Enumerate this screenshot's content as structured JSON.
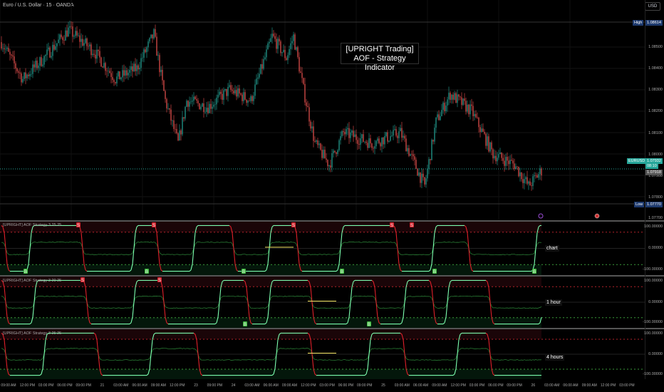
{
  "header": {
    "symbol_title": "Euro / U.S. Dollar · 15 · OANDA",
    "currency": "USD"
  },
  "annotation": {
    "line1": "[UPRIGHT Trading]",
    "line2": "AOF - Strategy Indicator"
  },
  "price_axis": {
    "labels": [
      "1.08500",
      "1.08400",
      "1.08300",
      "1.08200",
      "1.08100",
      "1.08000",
      "1.07900",
      "1.07800",
      "1.07700"
    ],
    "high_label": "High",
    "high_value": "1.08614",
    "low_label": "Low",
    "low_value": "1.07770",
    "symbol_tag": "EURUSD",
    "last_price": "1.07932",
    "countdown": "08:10",
    "prev_price": "1.07918"
  },
  "colors": {
    "bull": "#26a69a",
    "bear": "#ef5350",
    "osc_up": "#7dffb0",
    "osc_down": "#e0202a",
    "signal": "#f5e663"
  },
  "chart_data": {
    "type": "candlestick",
    "bars": 380,
    "price_range": [
      1.077,
      1.0862
    ],
    "price_path_keypoints": [
      [
        2,
        1.085
      ],
      [
        15,
        1.0835
      ],
      [
        30,
        1.0845
      ],
      [
        47,
        1.0858
      ],
      [
        65,
        1.0848
      ],
      [
        80,
        1.0835
      ],
      [
        95,
        1.084
      ],
      [
        107,
        1.0856
      ],
      [
        115,
        1.0825
      ],
      [
        124,
        1.0805
      ],
      [
        130,
        1.0825
      ],
      [
        145,
        1.0822
      ],
      [
        160,
        1.083
      ],
      [
        175,
        1.0825
      ],
      [
        190,
        1.0855
      ],
      [
        200,
        1.0845
      ],
      [
        205,
        1.0855
      ],
      [
        212,
        1.083
      ],
      [
        220,
        1.0805
      ],
      [
        230,
        1.0795
      ],
      [
        240,
        1.081
      ],
      [
        260,
        1.0805
      ],
      [
        280,
        1.081
      ],
      [
        297,
        1.0785
      ],
      [
        305,
        1.0815
      ],
      [
        315,
        1.0828
      ],
      [
        330,
        1.082
      ],
      [
        345,
        1.08
      ],
      [
        360,
        1.0795
      ],
      [
        370,
        1.0785
      ],
      [
        380,
        1.0793
      ]
    ]
  },
  "indicators": [
    {
      "title": "[UPRIGHT] AOF Strategy 3 25 25",
      "timeframe": "chart",
      "axis": [
        "100.00000",
        "0.00000",
        "-100.00000"
      ],
      "flips": [
        17,
        54,
        90,
        107,
        132,
        160,
        185,
        205,
        235,
        275,
        300,
        325,
        372
      ],
      "sell": [
        54,
        107,
        205,
        274,
        288
      ],
      "buy": [
        17,
        102,
        170,
        239,
        304,
        374
      ],
      "sell_label": "S",
      "buy_label": "B"
    },
    {
      "title": "[UPRIGHT] AOF Strategy 3 20 25",
      "timeframe": "1 hour",
      "axis": [
        "100.00000",
        "0.00000",
        "-100.00000"
      ],
      "flips": [
        20,
        57,
        90,
        111,
        150,
        170,
        185,
        215,
        242,
        260,
        280,
        300,
        310,
        340,
        377
      ],
      "sell": [
        57,
        111
      ],
      "buy": [
        171,
        258
      ],
      "sell_label": "S",
      "buy_label": "B"
    },
    {
      "title": "[UPRIGHT] AOF Strategy 3 25 25",
      "timeframe": "4 hours",
      "axis": [
        "100.00000",
        "0.00000",
        "-100.00000"
      ],
      "flips": [
        27,
        65,
        102,
        135,
        190,
        215,
        255,
        280,
        317,
        340,
        380
      ],
      "sell": [],
      "buy": [],
      "sell_label": "S",
      "buy_label": "B"
    }
  ],
  "time_axis": [
    "09:00 AM",
    "12:00 PM",
    "03:00 PM",
    "06:00 PM",
    "09:00 PM",
    "21",
    "03:00 AM",
    "06:00 AM",
    "09:00 AM",
    "12:00 PM",
    "23",
    "09:00 PM",
    "24",
    "03:00 AM",
    "06:00 AM",
    "09:00 AM",
    "12:00 PM",
    "03:00 PM",
    "06:00 PM",
    "09:00 PM",
    "25",
    "03:00 AM",
    "06:00 AM",
    "09:00 AM",
    "12:00 PM",
    "03:00 PM",
    "06:00 PM",
    "09:00 PM",
    "26",
    "03:00 AM",
    "06:00 AM",
    "09:00 AM",
    "12:00 PM",
    "03:00 PM"
  ]
}
